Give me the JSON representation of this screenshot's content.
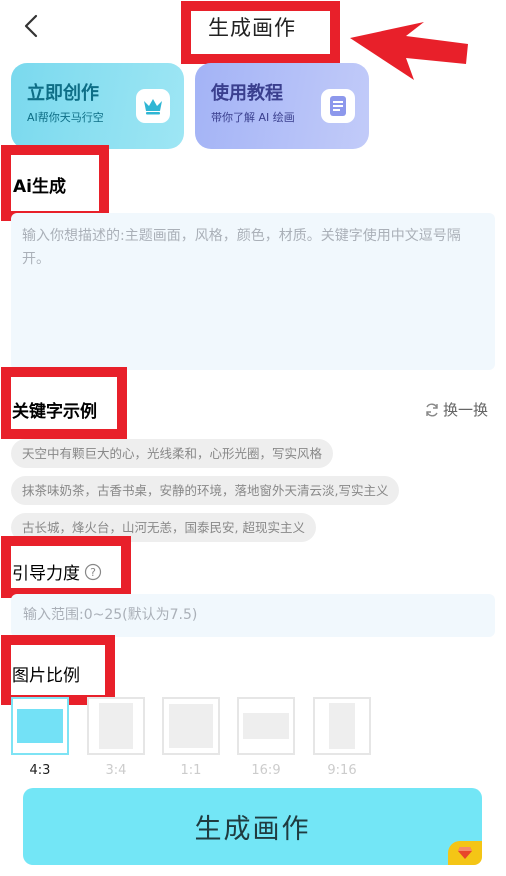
{
  "header": {
    "title": "生成画作"
  },
  "cards": {
    "create": {
      "title": "立即创作",
      "subtitle": "AI帮你天马行空"
    },
    "tutorial": {
      "title": "使用教程",
      "subtitle": "带你了解 AI 绘画"
    }
  },
  "ai_section": {
    "label": "Ai生成",
    "placeholder": "输入你想描述的:主题画面，风格，颜色，材质。关键字使用中文逗号隔开。"
  },
  "keywords": {
    "label": "关键字示例",
    "refresh_label": "换一换",
    "examples": [
      "天空中有颗巨大的心，光线柔和，心形光圈，写实风格",
      "抹茶味奶茶，古香书桌，安静的环境，落地窗外天清云淡,写实主义",
      "古长城，烽火台，山河无恙，国泰民安, 超现实主义"
    ]
  },
  "guidance": {
    "label": "引导力度",
    "placeholder": "输入范围:0~25(默认为7.5)"
  },
  "ratio": {
    "label": "图片比例",
    "options": [
      "4:3",
      "3:4",
      "1:1",
      "16:9",
      "9:16"
    ],
    "selected": "4:3"
  },
  "generate_button": {
    "label": "生成画作"
  },
  "colors": {
    "annotation_red": "#e8202a",
    "accent_cyan": "#73e6f6",
    "badge_yellow": "#f4c516"
  }
}
